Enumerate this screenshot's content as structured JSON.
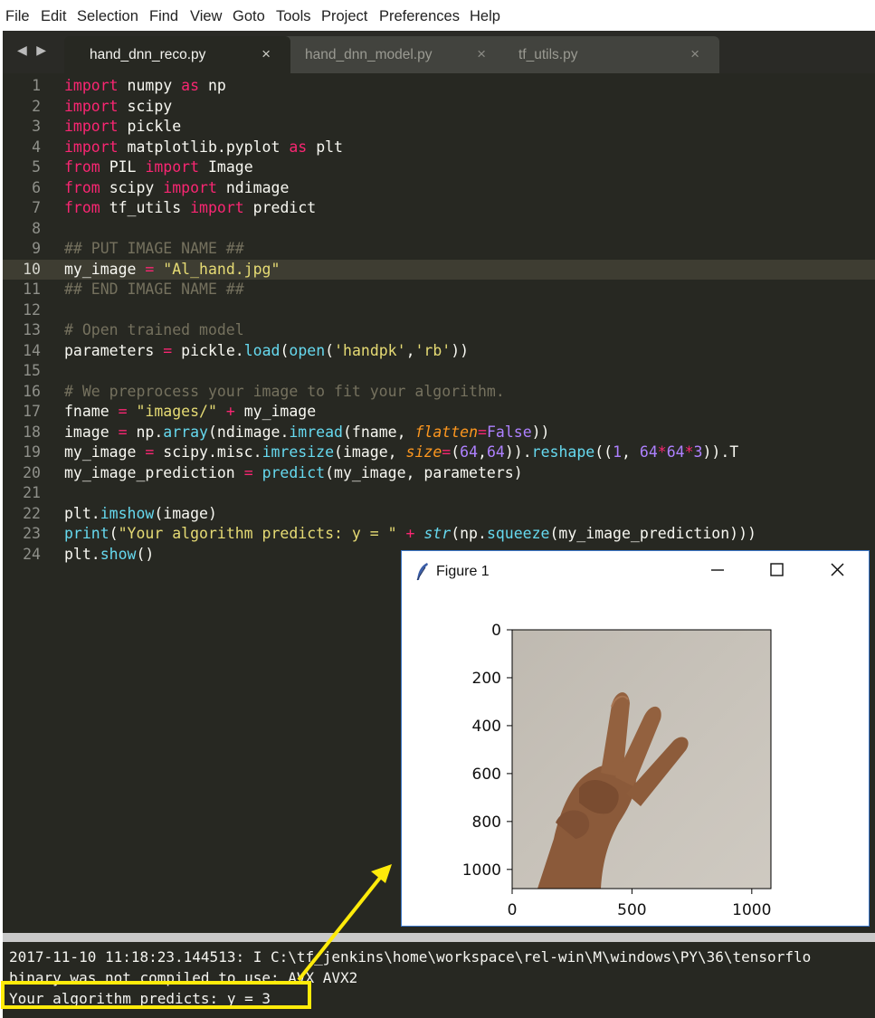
{
  "menu": [
    "File",
    "Edit",
    "Selection",
    "Find",
    "View",
    "Goto",
    "Tools",
    "Project",
    "Preferences",
    "Help"
  ],
  "tabs": [
    {
      "label": "hand_dnn_reco.py",
      "active": true
    },
    {
      "label": "hand_dnn_model.py",
      "active": false
    },
    {
      "label": "tf_utils.py",
      "active": false
    }
  ],
  "close_glyph": "×",
  "nav_arrows": "◀ ▶",
  "code_lines": [
    {
      "num": "1",
      "tokens": [
        [
          "k",
          "import"
        ],
        [
          "",
          "numpy"
        ],
        [
          "k",
          "as"
        ],
        [
          "",
          "np"
        ]
      ]
    },
    {
      "num": "2",
      "tokens": [
        [
          "k",
          "import"
        ],
        [
          "",
          "scipy"
        ]
      ]
    },
    {
      "num": "3",
      "tokens": [
        [
          "k",
          "import"
        ],
        [
          "",
          "pickle"
        ]
      ]
    },
    {
      "num": "4",
      "tokens": [
        [
          "k",
          "import"
        ],
        [
          "",
          "matplotlib.pyplot"
        ],
        [
          "k",
          "as"
        ],
        [
          "",
          "plt"
        ]
      ]
    },
    {
      "num": "5",
      "tokens": [
        [
          "k",
          "from"
        ],
        [
          "",
          "PIL"
        ],
        [
          "k",
          "import"
        ],
        [
          "",
          "Image"
        ]
      ]
    },
    {
      "num": "6",
      "tokens": [
        [
          "k",
          "from"
        ],
        [
          "",
          "scipy"
        ],
        [
          "k",
          "import"
        ],
        [
          "",
          "ndimage"
        ]
      ]
    },
    {
      "num": "7",
      "tokens": [
        [
          "k",
          "from"
        ],
        [
          "",
          "tf_utils"
        ],
        [
          "k",
          "import"
        ],
        [
          "",
          "predict"
        ]
      ]
    },
    {
      "num": "8",
      "tokens": []
    },
    {
      "num": "9",
      "tokens": [
        [
          "c",
          "## PUT IMAGE NAME ##"
        ]
      ]
    },
    {
      "num": "10",
      "tokens": [
        [
          "",
          "my_image "
        ],
        [
          "o",
          "="
        ],
        [
          "s",
          " \"Al_hand.jpg\""
        ]
      ]
    },
    {
      "num": "11",
      "tokens": [
        [
          "c",
          "## END IMAGE NAME ##"
        ]
      ]
    },
    {
      "num": "12",
      "tokens": []
    },
    {
      "num": "13",
      "tokens": [
        [
          "c",
          "# Open trained model"
        ]
      ]
    },
    {
      "num": "14",
      "tokens": [
        [
          "",
          "parameters "
        ],
        [
          "o",
          "="
        ],
        [
          "",
          " pickle."
        ],
        [
          "f",
          "load"
        ],
        [
          "",
          "("
        ],
        [
          "f",
          "open"
        ],
        [
          "",
          "("
        ],
        [
          "s",
          "'handpk'"
        ],
        [
          "",
          ","
        ],
        [
          "s",
          "'rb'"
        ],
        [
          "",
          "))"
        ]
      ]
    },
    {
      "num": "15",
      "tokens": []
    },
    {
      "num": "16",
      "tokens": [
        [
          "c",
          "# We preprocess your image to fit your algorithm."
        ]
      ]
    },
    {
      "num": "17",
      "tokens": [
        [
          "",
          "fname "
        ],
        [
          "o",
          "="
        ],
        [
          "s",
          " \"images/\""
        ],
        [
          "o",
          " +"
        ],
        [
          "",
          " my_image"
        ]
      ]
    },
    {
      "num": "18",
      "tokens": [
        [
          "",
          "image "
        ],
        [
          "o",
          "="
        ],
        [
          "",
          " np."
        ],
        [
          "f",
          "array"
        ],
        [
          "",
          "(ndimage."
        ],
        [
          "f",
          "imread"
        ],
        [
          "",
          "(fname, "
        ],
        [
          "p",
          "flatten"
        ],
        [
          "o",
          "="
        ],
        [
          "n",
          "False"
        ],
        [
          "",
          "))"
        ]
      ]
    },
    {
      "num": "19",
      "tokens": [
        [
          "",
          "my_image "
        ],
        [
          "o",
          "="
        ],
        [
          "",
          " scipy.misc."
        ],
        [
          "f",
          "imresize"
        ],
        [
          "",
          "(image, "
        ],
        [
          "p",
          "size"
        ],
        [
          "o",
          "="
        ],
        [
          "",
          "("
        ],
        [
          "n",
          "64"
        ],
        [
          "",
          ","
        ],
        [
          "n",
          "64"
        ],
        [
          "",
          "))."
        ],
        [
          "f",
          "reshape"
        ],
        [
          "",
          "(("
        ],
        [
          "n",
          "1"
        ],
        [
          "",
          ", "
        ],
        [
          "n",
          "64"
        ],
        [
          "o",
          "*"
        ],
        [
          "n",
          "64"
        ],
        [
          "o",
          "*"
        ],
        [
          "n",
          "3"
        ],
        [
          "",
          ")).T"
        ]
      ]
    },
    {
      "num": "20",
      "tokens": [
        [
          "",
          "my_image_prediction "
        ],
        [
          "o",
          "="
        ],
        [
          "",
          " "
        ],
        [
          "f",
          "predict"
        ],
        [
          "",
          "(my_image, parameters)"
        ]
      ]
    },
    {
      "num": "21",
      "tokens": []
    },
    {
      "num": "22",
      "tokens": [
        [
          "",
          "plt."
        ],
        [
          "f",
          "imshow"
        ],
        [
          "",
          "(image)"
        ]
      ]
    },
    {
      "num": "23",
      "tokens": [
        [
          "f",
          "print"
        ],
        [
          "",
          "("
        ],
        [
          "s",
          "\"Your algorithm predicts: y = \""
        ],
        [
          "o",
          " +"
        ],
        [
          "",
          " "
        ],
        [
          "fi",
          "str"
        ],
        [
          "",
          "(np."
        ],
        [
          "f",
          "squeeze"
        ],
        [
          "",
          "(my_image_prediction)))"
        ]
      ]
    },
    {
      "num": "24",
      "tokens": [
        [
          "",
          "plt."
        ],
        [
          "f",
          "show"
        ],
        [
          "",
          "()"
        ]
      ]
    }
  ],
  "current_line": "10",
  "console": {
    "lines": [
      "2017-11-10 11:18:23.144513: I C:\\tf_jenkins\\home\\workspace\\rel-win\\M\\windows\\PY\\36\\tensorflo",
      "binary was not compiled to use: AVX AVX2",
      "Your algorithm predicts: y = 3"
    ]
  },
  "figure": {
    "title": "Figure 1",
    "minimize": "—",
    "maximize": "☐",
    "close": "✕",
    "y_ticks": [
      "0",
      "200",
      "400",
      "600",
      "800",
      "1000"
    ],
    "x_ticks": [
      "0",
      "500",
      "1000"
    ]
  },
  "colors": {
    "editor_bg": "#272822",
    "highlight_box": "#ffeb0a",
    "arrow": "#ffeb0a",
    "photo_bg": "#c7c1b8",
    "hand": "#8c5e3e"
  }
}
